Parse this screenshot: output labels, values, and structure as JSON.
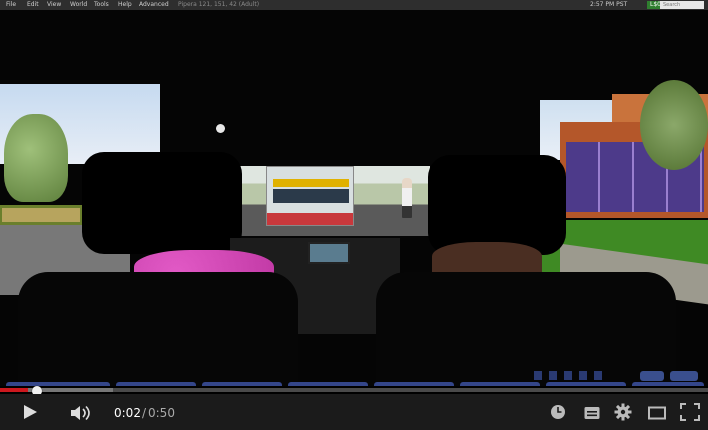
{
  "sl_menubar": {
    "menus": [
      "File",
      "Edit",
      "View",
      "World",
      "Tools",
      "Help",
      "Advanced"
    ],
    "coords": "Pipera 121, 151, 42 (Adult)",
    "time": "2:57 PM PST",
    "balance": "L$0",
    "search_placeholder": "Search"
  },
  "player": {
    "time_current": "0:02",
    "time_separator": "/",
    "time_duration": "0:50",
    "progress_fraction": 0.04,
    "buffered_fraction": 0.16,
    "accent_color": "#cc181e"
  },
  "icons": {
    "play": "play-icon",
    "volume": "volume-icon",
    "watch_later": "clock-icon",
    "captions": "captions-icon",
    "settings": "gear-icon",
    "theater": "theater-icon",
    "fullscreen": "fullscreen-icon"
  }
}
